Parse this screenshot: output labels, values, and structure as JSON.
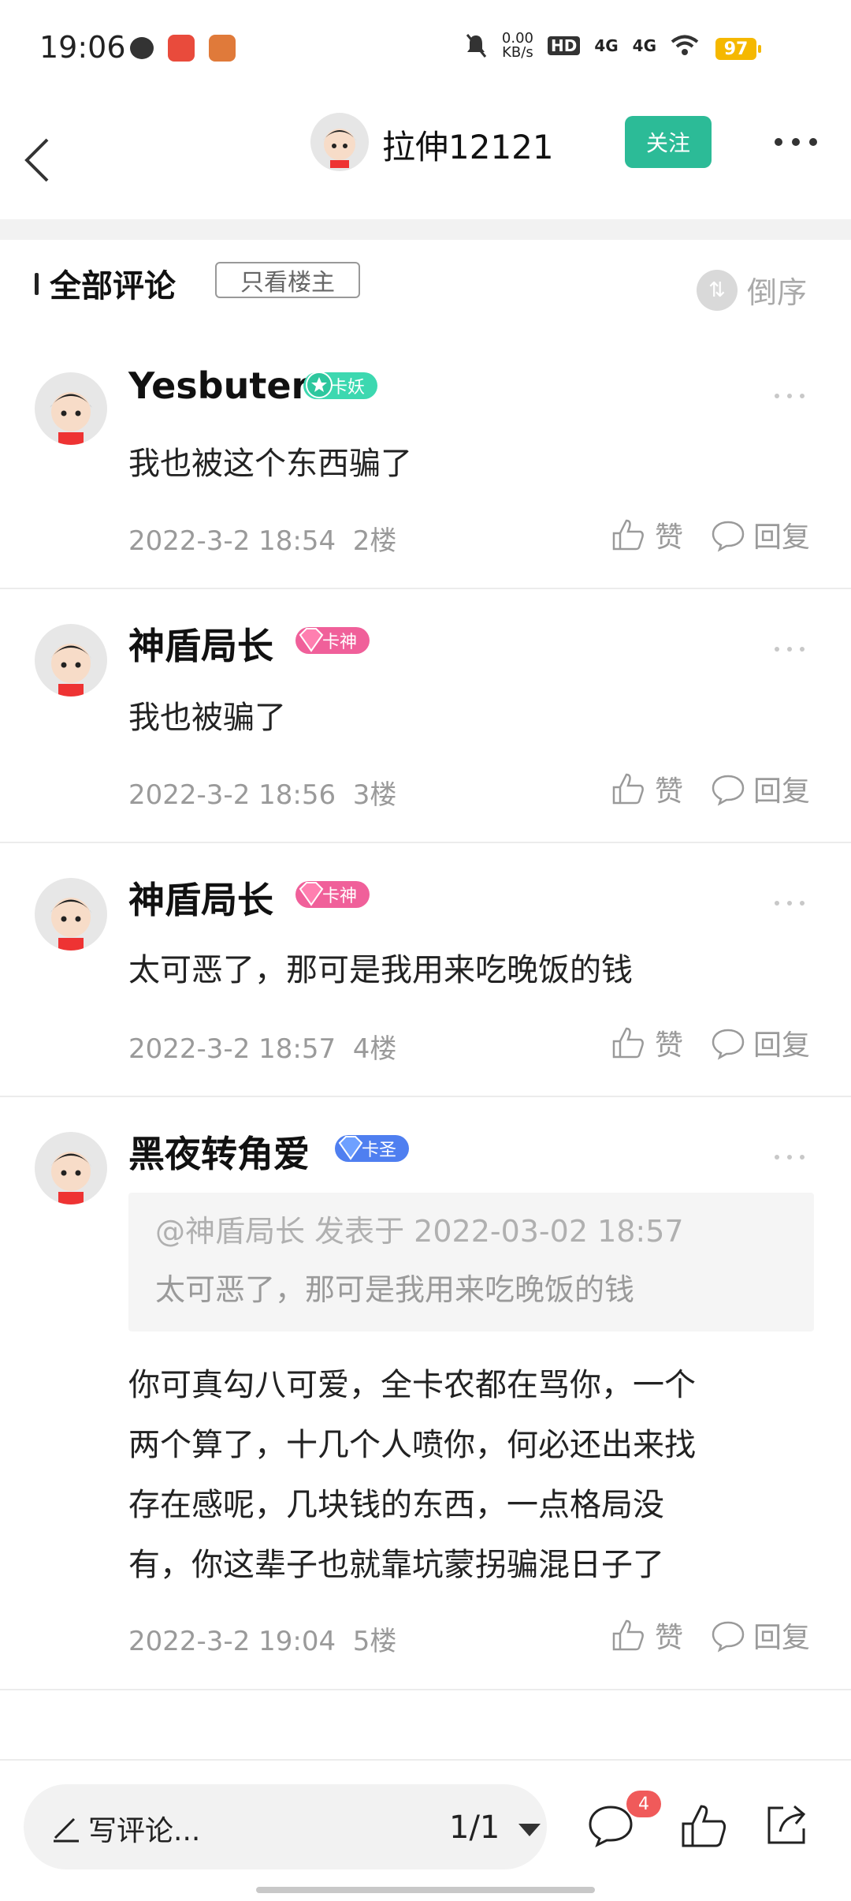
{
  "status_bar": {
    "time": "19:06",
    "net_speed_top": "0.00",
    "net_speed_bottom": "KB/s",
    "hd": "HD",
    "sig1": "4G",
    "sig2": "4G",
    "battery": "97"
  },
  "header": {
    "username": "拉伸12121",
    "follow_label": "关注"
  },
  "section": {
    "title": "全部评论",
    "only_op_label": "只看楼主",
    "sort_label": "倒序"
  },
  "comments": [
    {
      "author": "Yesbuter",
      "badge": "卡妖",
      "badge_color": "#3dd8b0",
      "text": "我也被这个东西骗了",
      "time": "2022-3-2 18:54",
      "floor": "2楼",
      "like_label": "赞",
      "reply_label": "回复"
    },
    {
      "author": "神盾局长",
      "badge": "卡神",
      "badge_color": "#f0609a",
      "text": "我也被骗了",
      "time": "2022-3-2 18:56",
      "floor": "3楼",
      "like_label": "赞",
      "reply_label": "回复"
    },
    {
      "author": "神盾局长",
      "badge": "卡神",
      "badge_color": "#f0609a",
      "text": "太可恶了，那可是我用来吃晚饭的钱",
      "time": "2022-3-2 18:57",
      "floor": "4楼",
      "like_label": "赞",
      "reply_label": "回复"
    },
    {
      "author": "黑夜转角爱",
      "badge": "卡圣",
      "badge_color": "#4f7ff0",
      "quote_head": "@神盾局长 发表于 2022-03-02 18:57",
      "quote_body": "太可恶了，那可是我用来吃晚饭的钱",
      "text_lines": [
        "你可真勾八可爱，全卡农都在骂你，一个",
        "两个算了，十几个人喷你，何必还出来找",
        "存在感呢，几块钱的东西，一点格局没",
        "有，你这辈子也就靠坑蒙拐骗混日子了"
      ],
      "time": "2022-3-2 19:04",
      "floor": "5楼",
      "like_label": "赞",
      "reply_label": "回复"
    }
  ],
  "bottom_bar": {
    "write_label": "写评论...",
    "pager": "1/1",
    "message_count": "4"
  },
  "colors": {
    "accent": "#2cbb97",
    "badge_red": "#f05a5a"
  }
}
